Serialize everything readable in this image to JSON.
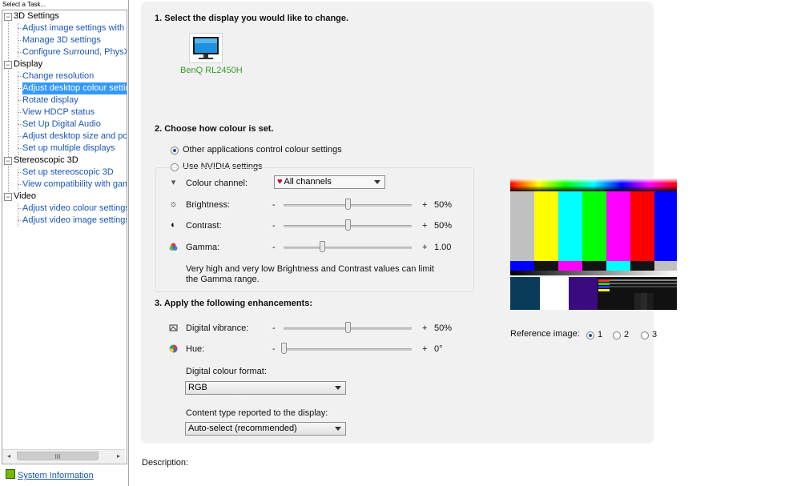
{
  "sidebar": {
    "title": "Select a Task...",
    "items": [
      {
        "label": "3D Settings",
        "kind": "category"
      },
      {
        "label": "Adjust image settings with pr",
        "kind": "link"
      },
      {
        "label": "Manage 3D settings",
        "kind": "link"
      },
      {
        "label": "Configure Surround, PhysX",
        "kind": "link"
      },
      {
        "label": "Display",
        "kind": "category"
      },
      {
        "label": "Change resolution",
        "kind": "link"
      },
      {
        "label": "Adjust desktop colour setting",
        "kind": "link",
        "selected": true
      },
      {
        "label": "Rotate display",
        "kind": "link"
      },
      {
        "label": "View HDCP status",
        "kind": "link"
      },
      {
        "label": "Set Up Digital Audio",
        "kind": "link"
      },
      {
        "label": "Adjust desktop size and posit",
        "kind": "link"
      },
      {
        "label": "Set up multiple displays",
        "kind": "link"
      },
      {
        "label": "Stereoscopic 3D",
        "kind": "category"
      },
      {
        "label": "Set up stereoscopic 3D",
        "kind": "link"
      },
      {
        "label": "View compatibility with game",
        "kind": "link"
      },
      {
        "label": "Video",
        "kind": "category"
      },
      {
        "label": "Adjust video colour settings",
        "kind": "link"
      },
      {
        "label": "Adjust video image settings",
        "kind": "link"
      }
    ],
    "toggle_symbol": "−",
    "scroll_left": "◂",
    "scroll_right": "▸",
    "scroll_grip": "III",
    "system_info": "System Information"
  },
  "step1": {
    "heading": "1. Select the display you would like to change.",
    "display_name": "BenQ RL2450H"
  },
  "step2": {
    "heading": "2. Choose how colour is set.",
    "option_other": "Other applications control colour settings",
    "option_nvidia": "Use NVIDIA settings",
    "channel_label": "Colour channel:",
    "channel_value": "All channels",
    "brightness_label": "Brightness:",
    "brightness_value": "50%",
    "brightness_level": 0.5,
    "contrast_label": "Contrast:",
    "contrast_value": "50%",
    "contrast_level": 0.5,
    "gamma_label": "Gamma:",
    "gamma_value": "1.00",
    "gamma_level": 0.3,
    "minus": "-",
    "plus": "+",
    "note_line1": "Very high and very low Brightness and Contrast values can limit",
    "note_line2": "the Gamma range."
  },
  "step3": {
    "heading": "3. Apply the following enhancements:",
    "vibrance_label": "Digital vibrance:",
    "vibrance_value": "50%",
    "vibrance_level": 0.5,
    "hue_label": "Hue:",
    "hue_value": "0°",
    "hue_level": 0.0,
    "format_label": "Digital colour format:",
    "format_value": "RGB",
    "content_label": "Content type reported to the display:",
    "content_value": "Auto-select (recommended)"
  },
  "reference": {
    "label": "Reference image:",
    "options": [
      "1",
      "2",
      "3"
    ],
    "selected": "1"
  },
  "description_label": "Description:",
  "icons": {
    "brightness": "sun-icon",
    "contrast": "contrast-icon",
    "gamma": "gamma-icon",
    "vibrance": "vibrance-icon",
    "hue": "hue-icon",
    "channel": "colour-channel-icon",
    "monitor": "monitor-icon",
    "system_info": "system-info-icon"
  },
  "colors": {
    "link": "#1a55b6",
    "selection": "#3399ff",
    "display_label": "#3a9a2a",
    "panel_bg": "#f1f1f1"
  }
}
